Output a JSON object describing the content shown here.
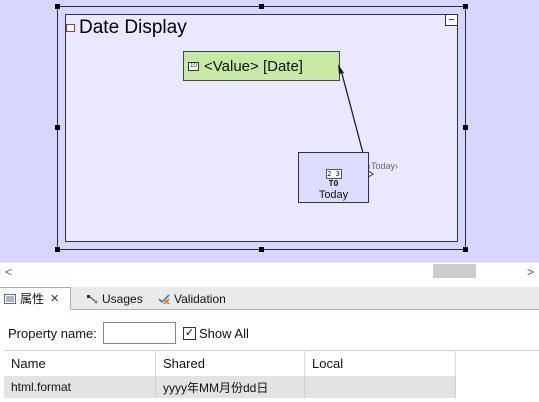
{
  "canvas": {
    "group_title": "Date Display",
    "value_node_label": "<Value> [Date]",
    "value_node_icon_text": "10",
    "today_node": {
      "icon_text": "2 3",
      "to_text": "TO",
      "label": "Today",
      "port_label": "Today"
    },
    "collapse_symbol": "−"
  },
  "scrollbar": {
    "left_arrow": "<",
    "right_arrow": ">"
  },
  "tabs": [
    {
      "label": "属性",
      "icon": "properties-icon",
      "active": true,
      "close": "✕"
    },
    {
      "label": "Usages",
      "icon": "usages-icon",
      "active": false
    },
    {
      "label": "Validation",
      "icon": "validation-icon",
      "active": false
    }
  ],
  "properties": {
    "name_label": "Property name:",
    "name_value": "",
    "show_all_label": "Show All",
    "show_all_checked": "✓",
    "columns": [
      "Name",
      "Shared",
      "Local"
    ],
    "rows": [
      {
        "name": "html.format",
        "shared": "yyyy年MM月份dd日",
        "local": ""
      }
    ]
  },
  "colors": {
    "canvas_bg": "#d6d6ff",
    "group_bg": "#e9e8ff",
    "value_node_bg": "#c6eaa4",
    "today_node_bg": "#dcdcff"
  }
}
